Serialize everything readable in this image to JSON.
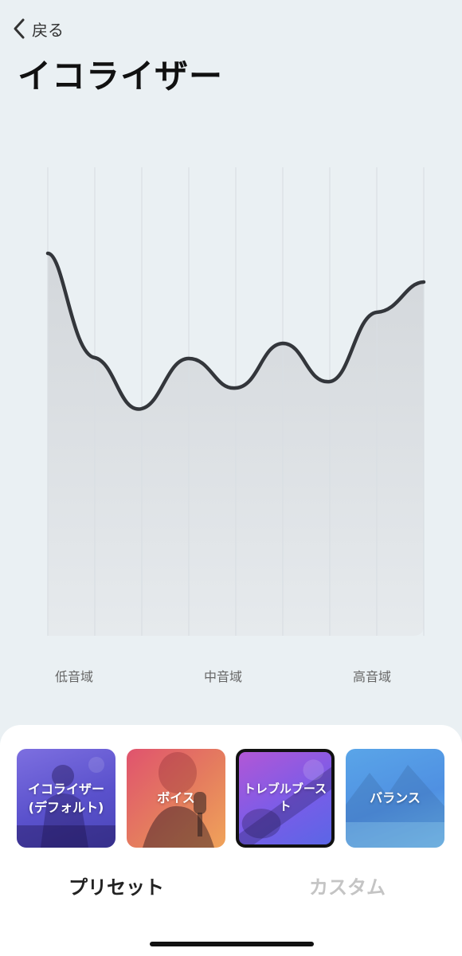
{
  "nav": {
    "back_label": "戻る"
  },
  "page": {
    "title": "イコライザー"
  },
  "equalizer": {
    "band_labels": [
      "低音域",
      "中音域",
      "高音域"
    ],
    "curve_color": "#33363b",
    "grid_color": "#d9dee3"
  },
  "presets": [
    {
      "label": "イコライザー\n(デフォルト)",
      "selected": false
    },
    {
      "label": "ボイス",
      "selected": false
    },
    {
      "label": "トレブルブースト",
      "selected": true
    },
    {
      "label": "バランス",
      "selected": false
    }
  ],
  "segments": {
    "active": "プリセット",
    "inactive": "カスタム"
  },
  "colors": {
    "background": "#eaf0f3",
    "sheet": "#ffffff",
    "active_text": "#222222",
    "inactive_text": "#c4c4c4"
  }
}
